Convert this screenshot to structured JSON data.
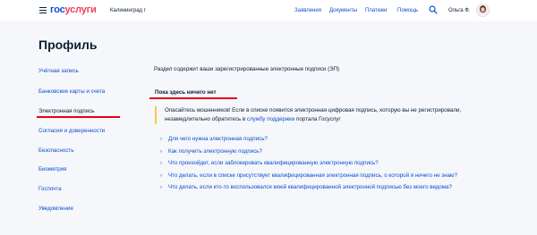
{
  "header": {
    "logo_gos": "гос",
    "logo_usl": "услуги",
    "city": "Калининград г",
    "nav": [
      "Заявления",
      "Документы",
      "Платежи",
      "Помощь"
    ],
    "user_name": "Ольга Ф."
  },
  "page_title": "Профиль",
  "sidebar": {
    "items": [
      {
        "label": "Учётная запись"
      },
      {
        "label": "Банковские карты и счета"
      },
      {
        "label": "Электронная подпись"
      },
      {
        "label": "Согласия и доверенности"
      },
      {
        "label": "Безопасность"
      },
      {
        "label": "Биометрия"
      },
      {
        "label": "Госпочта"
      },
      {
        "label": "Уведомления"
      }
    ],
    "active_index": 2
  },
  "main": {
    "lead": "Раздел содержит ваши зарегистрированные электронные подписи (ЭП)",
    "empty_note": "Пока здесь ничего нет",
    "warning": {
      "before": "Опасайтесь мошенников! Если в списке появится электронная цифровая подпись, которую вы не регистрировали, незамедлительно обратитесь в ",
      "link": "службу поддержки",
      "after": " портала Госуслуг"
    },
    "faq": [
      "Для чего нужна электронная подпись?",
      "Как получить электронную подпись?",
      "Что произойдет, если заблокировать квалифицированную электронную подпись?",
      "Что делать, если в списке присутствует квалифицированная электронная подпись, о которой я ничего не знаю?",
      "Что делать, если кто-то воспользовался моей квалифицированной электронной подписью без моего ведома?"
    ]
  },
  "colors": {
    "brand_blue": "#0d4cd3",
    "brand_red": "#ee3f58",
    "accent_underline": "#e3001b",
    "warning": "#f9c846",
    "background": "#f5f7fa"
  }
}
